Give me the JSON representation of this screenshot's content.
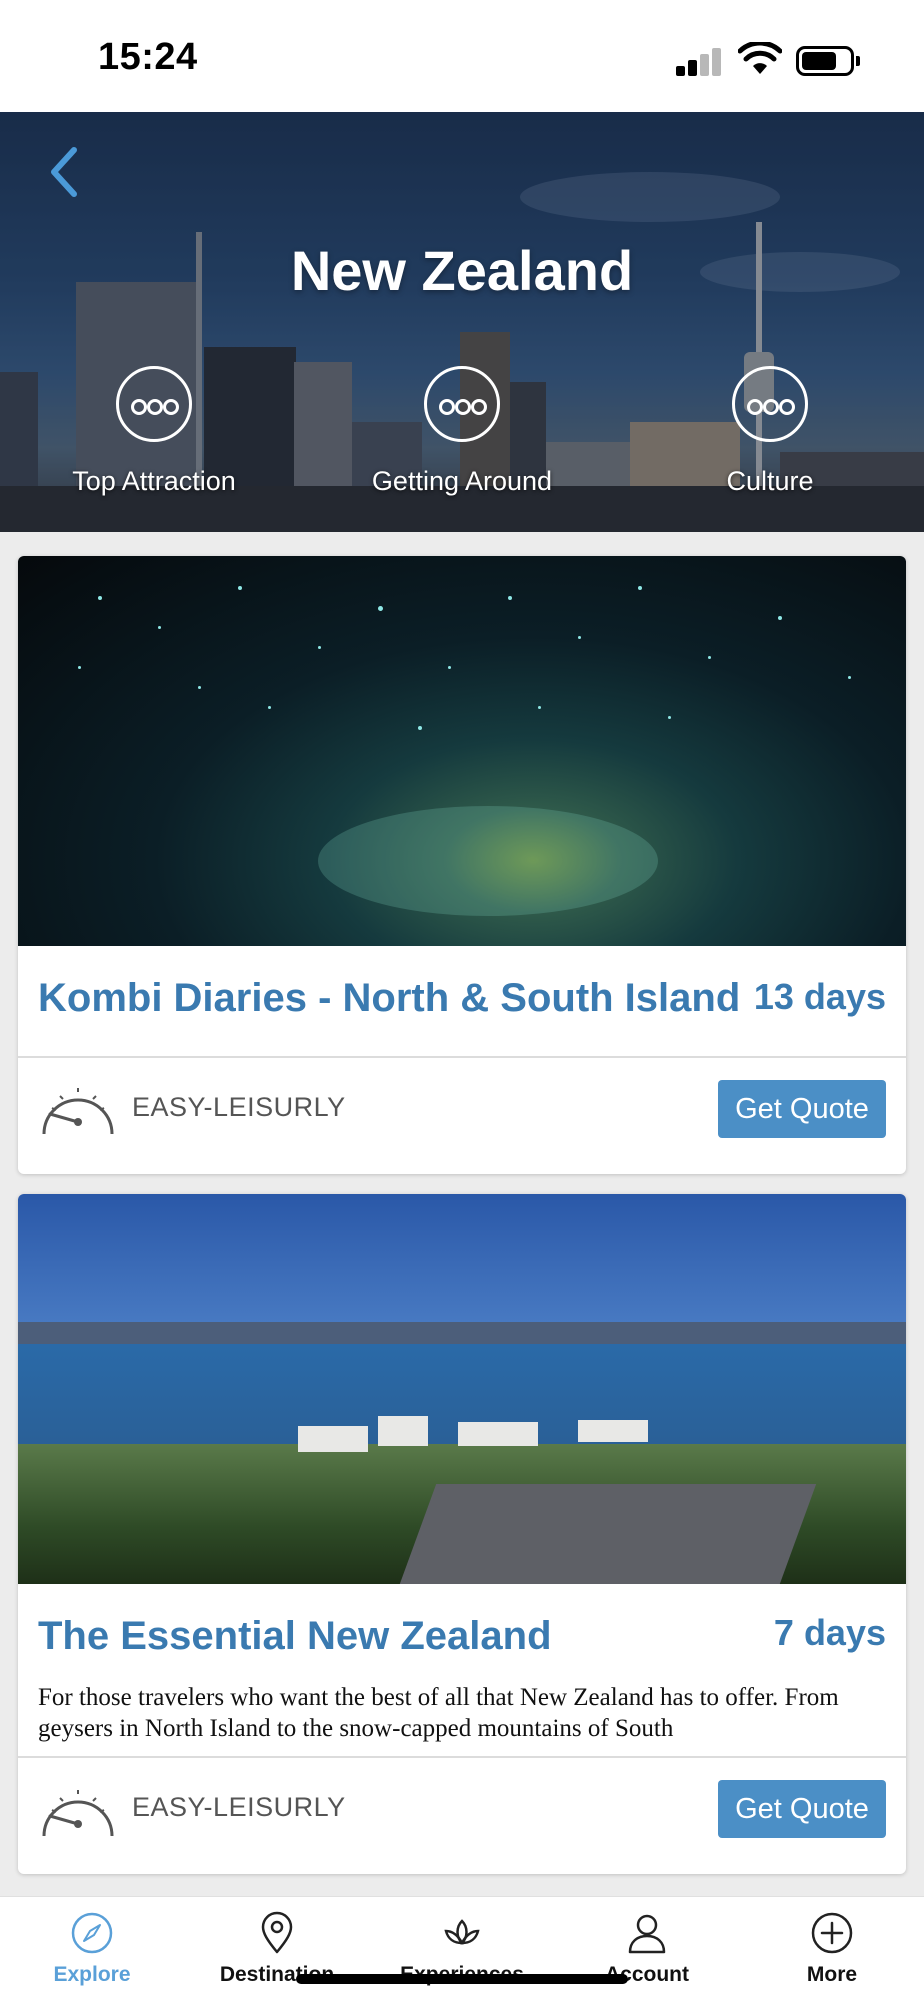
{
  "status_bar": {
    "time": "15:24"
  },
  "header": {
    "title": "New Zealand",
    "categories": [
      {
        "label": "Top Attraction",
        "icon": "more-dots-icon"
      },
      {
        "label": "Getting Around",
        "icon": "more-dots-icon"
      },
      {
        "label": "Culture",
        "icon": "more-dots-icon"
      }
    ]
  },
  "trips": [
    {
      "title": "Kombi Diaries - North & South Island",
      "days": "13 days",
      "description": "",
      "difficulty": "EASY-LEISURLY",
      "button": "Get Quote"
    },
    {
      "title": "The Essential New Zealand",
      "days": "7 days",
      "description": "For those travelers who want the best of all that New Zealand has to offer. From geysers in North Island to the snow-capped mountains of South",
      "difficulty": "EASY-LEISURLY",
      "button": "Get Quote"
    }
  ],
  "tabbar": {
    "tabs": [
      {
        "label": "Explore",
        "icon": "compass-icon",
        "active": true
      },
      {
        "label": "Destination",
        "icon": "map-pin-icon",
        "active": false
      },
      {
        "label": "Experiences",
        "icon": "lotus-icon",
        "active": false
      },
      {
        "label": "Account",
        "icon": "user-icon",
        "active": false
      },
      {
        "label": "More",
        "icon": "plus-circle-icon",
        "active": false
      }
    ]
  },
  "colors": {
    "accent": "#3a7ab0",
    "button": "#4b8fc6",
    "active_tab": "#5aa0d8"
  }
}
